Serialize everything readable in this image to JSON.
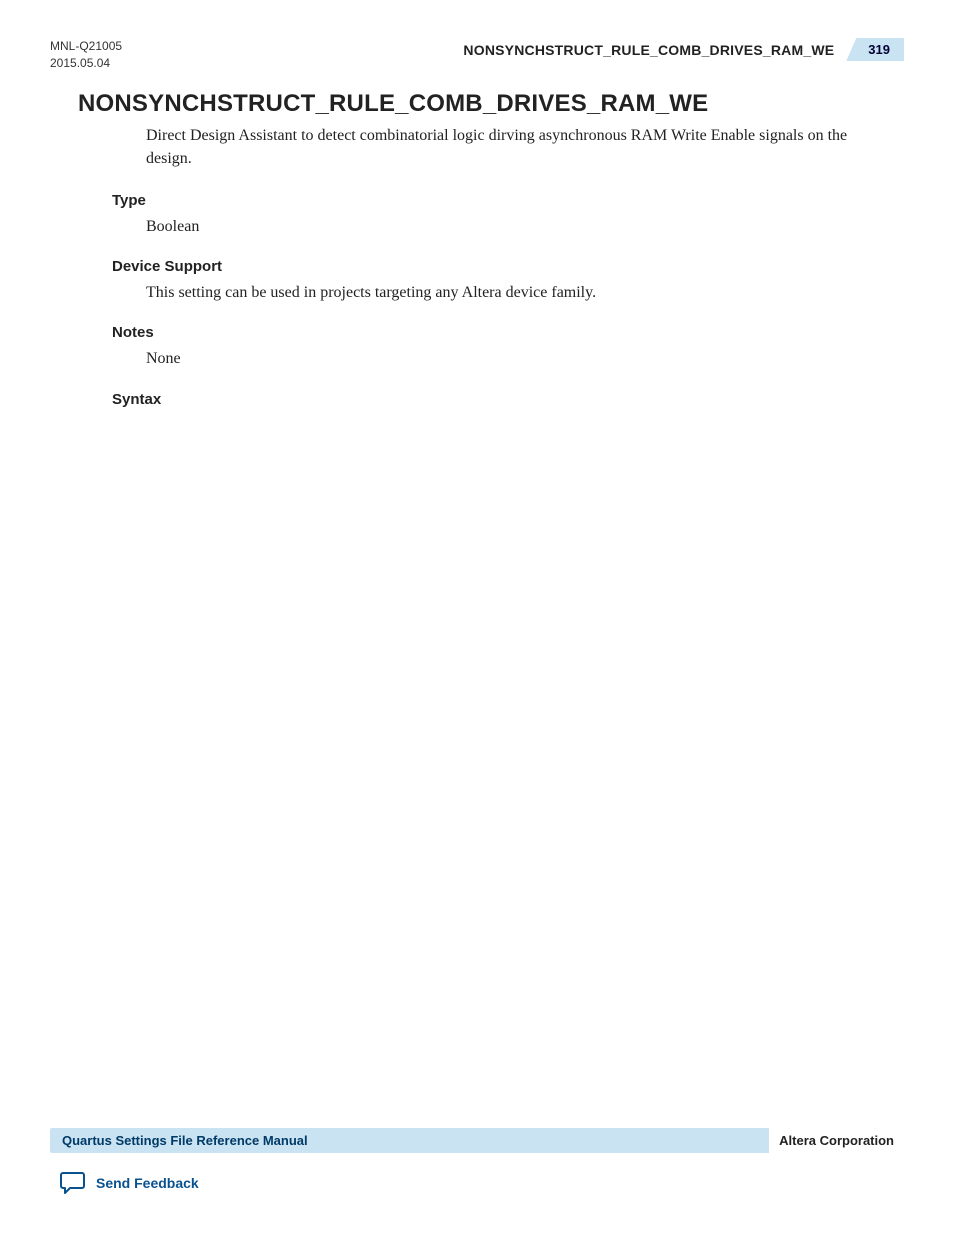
{
  "header": {
    "doc_id": "MNL-Q21005",
    "date": "2015.05.04",
    "running_title": "NONSYNCHSTRUCT_RULE_COMB_DRIVES_RAM_WE",
    "page_number": "319"
  },
  "title": "NONSYNCHSTRUCT_RULE_COMB_DRIVES_RAM_WE",
  "intro": "Direct Design Assistant to detect combinatorial logic dirving asynchronous RAM Write Enable signals on the design.",
  "sections": {
    "type": {
      "heading": "Type",
      "body": "Boolean"
    },
    "device_support": {
      "heading": "Device Support",
      "body": "This setting can be used in projects targeting any Altera device family."
    },
    "notes": {
      "heading": "Notes",
      "body": "None"
    },
    "syntax": {
      "heading": "Syntax",
      "body": ""
    }
  },
  "footer": {
    "manual_title": "Quartus Settings File Reference Manual",
    "company": "Altera Corporation",
    "feedback_label": "Send Feedback"
  }
}
